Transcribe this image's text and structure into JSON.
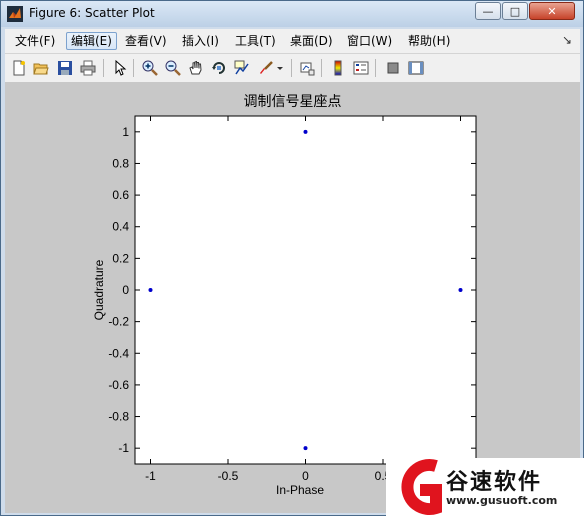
{
  "window": {
    "title": "Figure 6: Scatter Plot",
    "buttons": {
      "minimize": "—",
      "maximize": "□",
      "close": "✕"
    }
  },
  "menubar": {
    "items": [
      "文件(F)",
      "编辑(E)",
      "查看(V)",
      "插入(I)",
      "工具(T)",
      "桌面(D)",
      "窗口(W)",
      "帮助(H)"
    ],
    "active_index": 1,
    "overflow": "↘"
  },
  "toolbar": {
    "icons": [
      "new-figure-icon",
      "open-file-icon",
      "save-icon",
      "print-icon",
      "pointer-icon",
      "zoom-in-icon",
      "zoom-out-icon",
      "pan-hand-icon",
      "rotate-3d-icon",
      "data-cursor-icon",
      "brush-icon",
      "link-plot-icon",
      "colorbar-icon",
      "legend-icon",
      "hide-plot-tools-icon",
      "show-plot-tools-icon"
    ]
  },
  "chart_data": {
    "type": "scatter",
    "title": "调制信号星座点",
    "xlabel": "In-Phase",
    "ylabel": "Quadrature",
    "xlim": [
      -1.1,
      1.1
    ],
    "ylim": [
      -1.1,
      1.1
    ],
    "xticks": [
      -1,
      -0.5,
      0,
      0.5,
      1
    ],
    "xtick_labels": [
      "-1",
      "-0.5",
      "0",
      "0.5",
      ""
    ],
    "yticks": [
      1,
      0.8,
      0.6,
      0.4,
      0.2,
      0,
      -0.2,
      -0.4,
      -0.6,
      -0.8,
      -1
    ],
    "ytick_labels": [
      "1",
      "0.8",
      "0.6",
      "0.4",
      "0.2",
      "0",
      "-0.2",
      "-0.4",
      "-0.6",
      "-0.8",
      "-1"
    ],
    "points": [
      {
        "x": 0,
        "y": 1
      },
      {
        "x": -1,
        "y": 0
      },
      {
        "x": 1,
        "y": 0
      },
      {
        "x": 0,
        "y": -1
      }
    ],
    "marker_color": "#0000cc",
    "grid": false
  },
  "watermark": {
    "brand": "谷速软件",
    "url": "www.gusuoft.com",
    "color": "#e0141e"
  }
}
